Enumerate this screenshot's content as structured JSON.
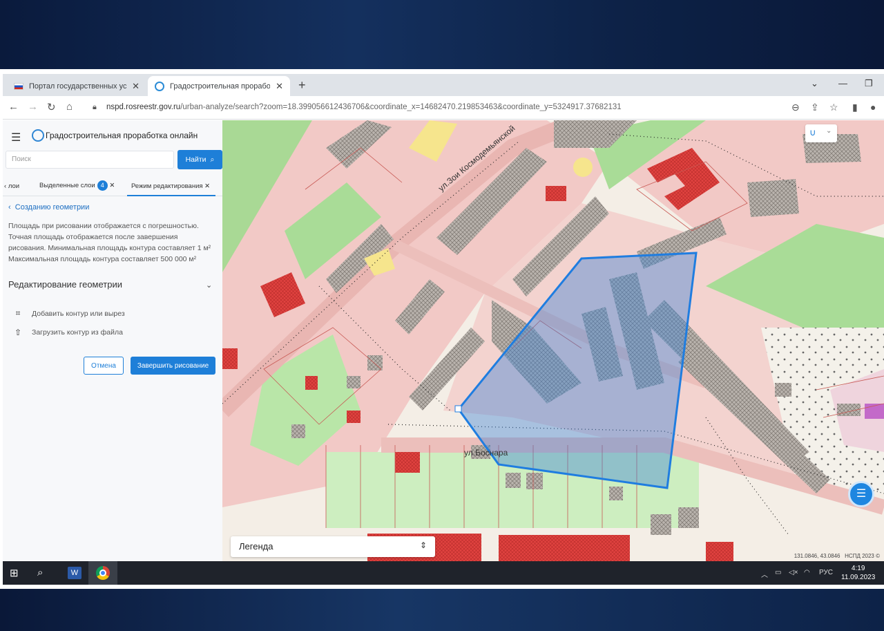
{
  "browser": {
    "tabs": [
      {
        "title": "Портал государственных услуг Р",
        "active": false
      },
      {
        "title": "Градостроительная проработка",
        "active": true
      }
    ],
    "new_tab_symbol": "+",
    "url_host": "nspd.rosreestr.gov.ru",
    "url_path": "/urban-analyze/search?zoom=18.399056612436706&coordinate_x=14682470.219853463&coordinate_y=5324917.37682131"
  },
  "app": {
    "title": "Градостроительная проработка онлайн",
    "search_placeholder": "Поиск",
    "find_button": "Найти",
    "panel_tabs": [
      {
        "label": "лои"
      },
      {
        "label": "Выделенные слои",
        "badge": "4"
      },
      {
        "label": "Режим редактирования",
        "active": true
      }
    ],
    "back_link": "Созданию геометрии",
    "info_text": "Площадь при рисовании отображается с погрешностью. Точная площадь отображается после завершения рисования. Минимальная площадь контура составляет 1 м² Максимальная площадь контура составляет 500 000 м²",
    "section_title": "Редактирование геометрии",
    "actions": [
      {
        "label": "Добавить контур или вырез",
        "icon": "add-contour-icon"
      },
      {
        "label": "Загрузить контур из файла",
        "icon": "upload-icon"
      }
    ],
    "cancel_button": "Отмена",
    "finish_button": "Завершить рисование"
  },
  "map": {
    "street_labels": [
      "ул.Зои Космодемьянской",
      "ул.Боснара"
    ],
    "legend_label": "Легенда",
    "copyright": "НСПД 2023 ©",
    "scale_text": "131.0846, 43.0846",
    "colors": {
      "polygon_stroke": "#1f7de0",
      "polygon_fill": "#3d84d6",
      "zone_pink": "#f2c9c6",
      "zone_green": "#b9e6a8",
      "building_red": "#e0423f"
    }
  },
  "taskbar": {
    "language": "РУС",
    "time": "4:19",
    "date": "11.09.2023"
  }
}
